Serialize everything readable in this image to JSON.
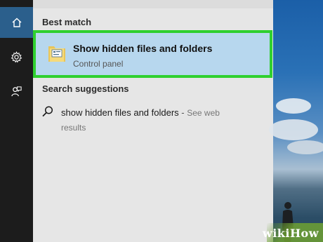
{
  "best_match": {
    "section_label": "Best match",
    "title": "Show hidden files and folders",
    "subtitle": "Control panel"
  },
  "suggestions": {
    "section_label": "Search suggestions",
    "items": [
      {
        "query": "show hidden files and folders",
        "separator": " - ",
        "hint": "See web",
        "hint_line2": "results"
      }
    ]
  },
  "rail": {
    "icons": [
      "home-icon",
      "gear-icon",
      "feedback-icon"
    ]
  },
  "watermark": {
    "text": "wikiHow"
  },
  "colors": {
    "highlight": "#b7d7ee",
    "border_highlight": "#2fd02f",
    "rail": "#1c1c1c",
    "rail_active": "#2b5f8c",
    "panel": "#e6e6e6"
  }
}
